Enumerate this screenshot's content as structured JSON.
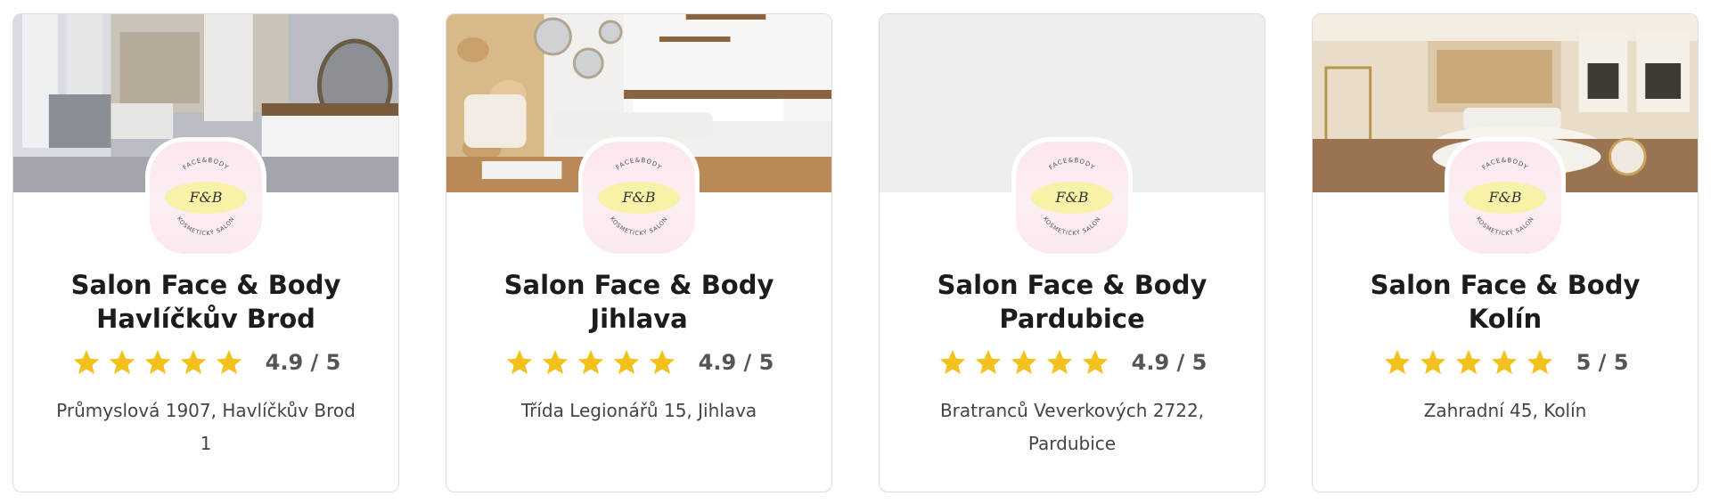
{
  "logo_text": {
    "top": "FACE&BODY",
    "mark": "F&B",
    "bottom": "KOSMETICKÝ SALON"
  },
  "colors": {
    "star": "#f4c21c",
    "logo_bg": "#fbe6ef",
    "logo_wash": "#f6f29a"
  },
  "cards": [
    {
      "name_line1": "Salon Face & Body",
      "name_line2": "Havlíčkův Brod",
      "score": "4.9 / 5",
      "stars": 5,
      "address": "Průmyslová 1907, Havlíčkův Brod 1",
      "photo": "salon-interior-photo"
    },
    {
      "name_line1": "Salon Face & Body",
      "name_line2": "Jihlava",
      "score": "4.9 / 5",
      "stars": 5,
      "address": "Třída Legionářů 15, Jihlava",
      "photo": "salon-interior-photo"
    },
    {
      "name_line1": "Salon Face & Body",
      "name_line2": "Pardubice",
      "score": "4.9 / 5",
      "stars": 5,
      "address": "Bratranců Veverkových 2722, Pardubice",
      "photo": "placeholder-empty"
    },
    {
      "name_line1": "Salon Face & Body Kolín",
      "name_line2": "",
      "score": "5 / 5",
      "stars": 5,
      "address": "Zahradní 45, Kolín",
      "photo": "salon-interior-photo"
    }
  ]
}
